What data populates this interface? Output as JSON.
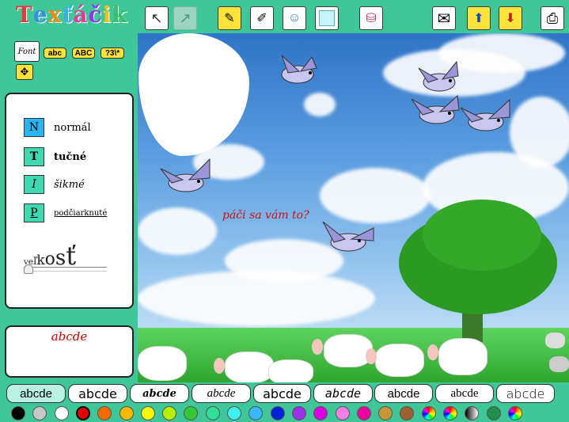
{
  "app": {
    "title": "Texťáčik"
  },
  "logo_colors": [
    "#e63a3a",
    "#3a8ae6",
    "#f28a1a",
    "#3ab0e6",
    "#e63a9a",
    "#8a3ae6",
    "#f2c01a",
    "#3ac06a"
  ],
  "toolbar": {
    "buttons": [
      {
        "name": "cursor-arrow-button",
        "icon": "arrow-icon",
        "glyph": "↖",
        "state": "active"
      },
      {
        "name": "disabled-arrow-button",
        "icon": "arrow-grey-icon",
        "glyph": "↗",
        "state": "disabled"
      },
      {
        "name": "pen-button",
        "icon": "pen-icon",
        "glyph": "✎",
        "state": "active"
      },
      {
        "name": "pencil-button",
        "icon": "pencil-icon",
        "glyph": "✐",
        "state": "normal"
      },
      {
        "name": "face-button",
        "icon": "face-icon",
        "glyph": "☺",
        "state": "normal"
      },
      {
        "name": "frame-button",
        "icon": "frame-icon",
        "glyph": "▢",
        "state": "normal"
      },
      {
        "name": "paint-button",
        "icon": "paint-can-icon",
        "glyph": "⛁",
        "state": "normal"
      },
      {
        "name": "mail-button",
        "icon": "envelope-icon",
        "glyph": "✉",
        "state": "normal"
      },
      {
        "name": "save-button",
        "icon": "box-up-icon",
        "glyph": "⬆",
        "state": "normal"
      },
      {
        "name": "load-button",
        "icon": "box-down-icon",
        "glyph": "⬇",
        "state": "normal"
      },
      {
        "name": "print-button",
        "icon": "printer-icon",
        "glyph": "⎙",
        "state": "normal"
      }
    ]
  },
  "font_panel": {
    "font_button": "Font",
    "case_buttons": [
      "abc",
      "ABC",
      "?3\\*"
    ],
    "styles": [
      {
        "key": "N",
        "label": "normál"
      },
      {
        "key": "T",
        "label": "tučné"
      },
      {
        "key": "I",
        "label": "šikmé"
      },
      {
        "key": "P",
        "label": "podčiarknuté"
      }
    ],
    "size_label": [
      "v",
      "e",
      "ľ",
      "k",
      "o",
      "s",
      "ť"
    ],
    "preview": "abcde"
  },
  "canvas": {
    "text": "páči sa vám to?"
  },
  "fonts": [
    "abcde",
    "abcde",
    "abcde",
    "abcde",
    "abcde",
    "abcde",
    "abcde",
    "abcde",
    "abcde"
  ],
  "colors": [
    "#000000",
    "#c8c8c8",
    "#ffffff",
    "#e00000",
    "#f26a00",
    "#f6b800",
    "#f8f800",
    "#b6f000",
    "#34c834",
    "#30e09a",
    "#40f0f0",
    "#38b8ff",
    "#0022dd",
    "#9a30e8",
    "#d800e0",
    "#f080e8",
    "#ee00a0",
    "#c89838",
    "#a06030",
    "#rainbow1",
    "#rainbow2",
    "#gradient",
    "#green2",
    "#rainbow3"
  ]
}
